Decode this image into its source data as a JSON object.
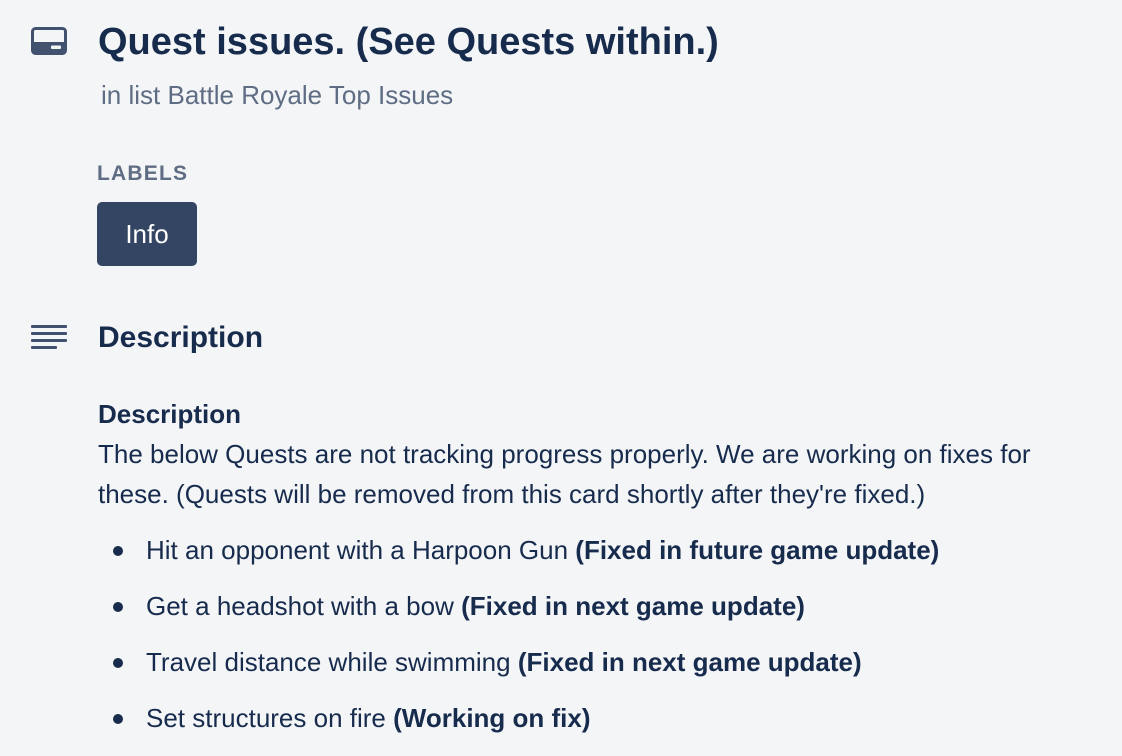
{
  "card": {
    "title": "Quest issues. (See Quests within.)",
    "list_prefix": "in list",
    "list_name": "Battle Royale Top Issues"
  },
  "labels": {
    "heading": "LABELS",
    "items": [
      {
        "text": "Info",
        "color": "#344563"
      }
    ]
  },
  "description": {
    "heading": "Description",
    "subheading": "Description",
    "paragraph": "The below Quests are not tracking progress properly. We are working on fixes for these. (Quests will be removed from this card shortly after they're fixed.)",
    "items": [
      {
        "text": "Hit an opponent with a Harpoon Gun",
        "status": "(Fixed in future game update)"
      },
      {
        "text": "Get a headshot with a bow",
        "status": "(Fixed in next game update)"
      },
      {
        "text": "Travel distance while swimming",
        "status": "(Fixed in next game update)"
      },
      {
        "text": "Set structures on fire",
        "status": "(Working on fix)"
      }
    ]
  },
  "icons": {
    "card": "card-icon",
    "description": "description-lines-icon"
  },
  "colors": {
    "background": "#f4f5f7",
    "text": "#172b4d",
    "muted": "#5e6c84",
    "label": "#344563"
  }
}
